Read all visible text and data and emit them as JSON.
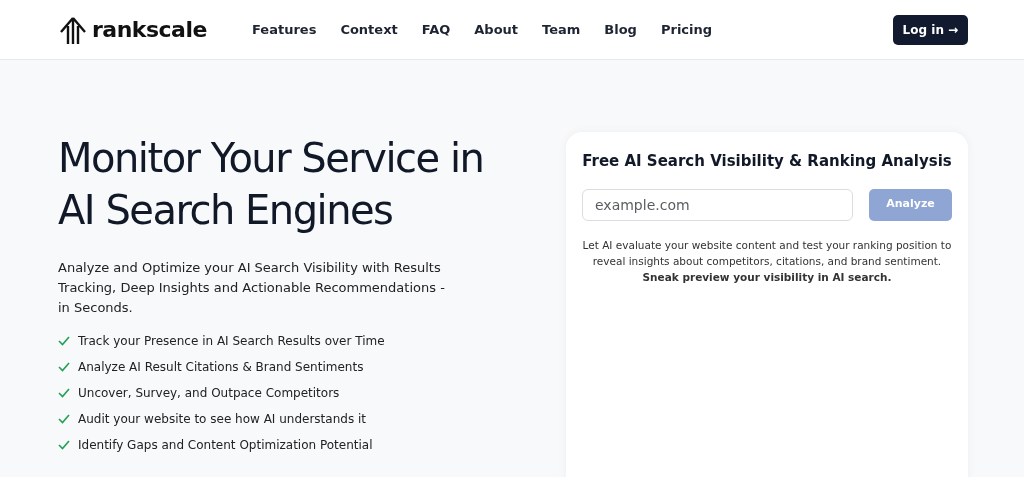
{
  "brand": "rankscale",
  "nav": [
    {
      "label": "Features"
    },
    {
      "label": "Context"
    },
    {
      "label": "FAQ"
    },
    {
      "label": "About"
    },
    {
      "label": "Team"
    },
    {
      "label": "Blog"
    },
    {
      "label": "Pricing"
    }
  ],
  "login_button": {
    "label": "Log in",
    "arrow": "→"
  },
  "hero": {
    "title": "Monitor Your Service in AI Search Engines",
    "subtitle": "Analyze and Optimize your AI Search Visibility with Results Tracking, Deep Insights and Actionable Recommendations - in Seconds.",
    "features": [
      "Track your Presence in AI Search Results over Time",
      "Analyze AI Result Citations & Brand Sentiments",
      "Uncover, Survey, and Outpace Competitors",
      "Audit your website to see how AI understands it",
      "Identify Gaps and Content Optimization Potential"
    ]
  },
  "analysis_card": {
    "title": "Free AI Search Visibility & Ranking Analysis",
    "url_field": {
      "placeholder": "example.com"
    },
    "analyze_button": {
      "label": "Analyze",
      "disabled": true
    },
    "description": "Let AI evaluate your website content and test your ranking position to reveal insights about competitors, citations, and brand sentiment. **Sneak preview your visibility in AI search.**"
  }
}
